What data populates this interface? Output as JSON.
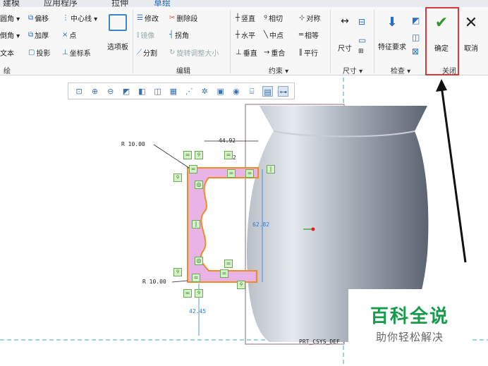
{
  "tabs": [
    {
      "label": "建模"
    },
    {
      "label": "应用程序"
    },
    {
      "label": "拉伸"
    },
    {
      "label": "草绘"
    }
  ],
  "ribbon": {
    "col1": [
      "圆角 ▾",
      "倒角 ▾",
      "文本"
    ],
    "col2": [
      "偏移",
      "加厚",
      "投影"
    ],
    "col3": [
      "中心线 ▾",
      "点",
      "坐标系"
    ],
    "options_label": "选项板",
    "edit": [
      "修改",
      "删除段",
      "镜像",
      "拐角",
      "分割",
      "旋转调整大小"
    ],
    "constraints": [
      "竖直",
      "相切",
      "对称",
      "水平",
      "中点",
      "相等",
      "垂直",
      "重合",
      "平行"
    ],
    "dim_label": "尺寸",
    "inspect_label": "特征要求",
    "ok_label": "确定",
    "cancel_label": "取消",
    "groups": [
      "绘",
      "编辑",
      "约束 ▾",
      "尺寸 ▾",
      "检查 ▾",
      "关闭"
    ]
  },
  "dims": {
    "r_top": "R 10.00",
    "r_bottom": "R 10.00",
    "width": "44.92",
    "height": "62.82",
    "bottom": "42.45",
    "coord": "PRT_CSYS_DEF",
    "eq": "2"
  },
  "watermark": {
    "title": "百科全说",
    "subtitle": "助你轻松解决"
  }
}
